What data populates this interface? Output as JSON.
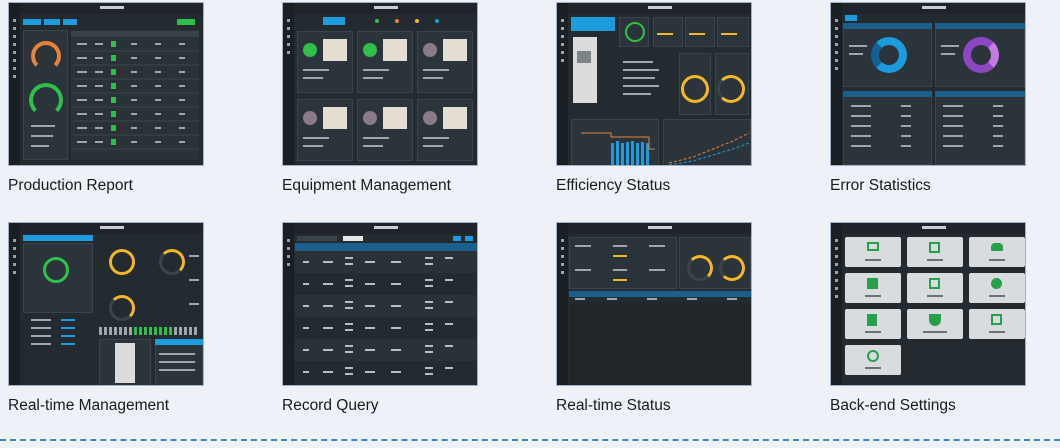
{
  "screens": [
    {
      "caption": "Production Report"
    },
    {
      "caption": "Equipment Management"
    },
    {
      "caption": "Efficiency Status"
    },
    {
      "caption": "Error Statistics"
    },
    {
      "caption": "Real-time Management"
    },
    {
      "caption": "Record Query"
    },
    {
      "caption": "Real-time Status"
    },
    {
      "caption": "Back-end Settings"
    }
  ],
  "colors": {
    "accent": "#1e9bdc",
    "ok_green": "#2fbf4a",
    "warn_orange": "#e8823a",
    "gauge_yellow": "#f3b72a",
    "donut_purple": "#8e47c2",
    "separator": "#3f86c7"
  }
}
